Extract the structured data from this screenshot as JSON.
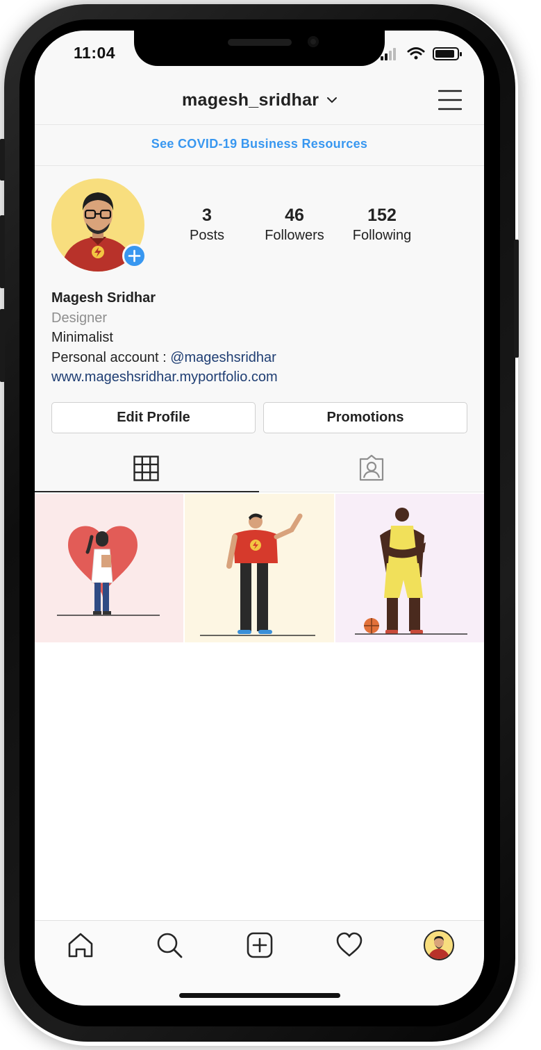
{
  "status_bar": {
    "time": "11:04"
  },
  "header": {
    "username": "magesh_sridhar",
    "username_chevron_icon": "chevron-down-icon",
    "menu_icon": "hamburger-menu-icon"
  },
  "covid_banner": {
    "link_text": "See COVID-19 Business Resources",
    "color": "#3897f0"
  },
  "profile": {
    "stats": [
      {
        "value": "3",
        "label": "Posts"
      },
      {
        "value": "46",
        "label": "Followers"
      },
      {
        "value": "152",
        "label": "Following"
      }
    ],
    "full_name": "Magesh Sridhar",
    "occupation": "Designer",
    "bio_line": "Minimalist",
    "personal_account_prefix": "Personal account : ",
    "personal_account_handle": "@mageshsridhar",
    "website": "www.mageshsridhar.myportfolio.com",
    "avatar_bg": "#f8de7e",
    "add_story_color": "#3897f0"
  },
  "buttons": {
    "edit_profile": "Edit Profile",
    "promotions": "Promotions"
  },
  "tabs": [
    {
      "name": "grid",
      "icon": "grid-icon",
      "active": true
    },
    {
      "name": "tagged",
      "icon": "tagged-person-icon",
      "active": false
    }
  ],
  "posts": [
    {
      "subject": "doctor-with-heart",
      "bg": "#fbeaea"
    },
    {
      "subject": "man-in-flash-shirt",
      "bg": "#fdf6e3"
    },
    {
      "subject": "basketball-player",
      "bg": "#f8eef8"
    }
  ],
  "bottom_nav": [
    {
      "name": "home",
      "icon": "home-icon"
    },
    {
      "name": "search",
      "icon": "search-icon"
    },
    {
      "name": "new-post",
      "icon": "plus-square-icon"
    },
    {
      "name": "activity",
      "icon": "heart-icon"
    },
    {
      "name": "profile",
      "icon": "profile-avatar"
    }
  ]
}
